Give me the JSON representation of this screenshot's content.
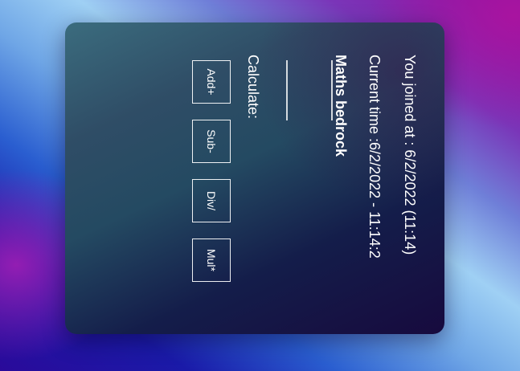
{
  "session": {
    "joined_text": "You joined at : 6/2/2022 (11:14)",
    "current_time_text": "Current time :6/2/2022 - 11:14:2"
  },
  "app": {
    "title": "Maths bedrock"
  },
  "calculator": {
    "label": "Calculate:",
    "buttons": {
      "add": "Add+",
      "sub": "Sub-",
      "div": "Div/",
      "mul": "Mul*"
    }
  }
}
